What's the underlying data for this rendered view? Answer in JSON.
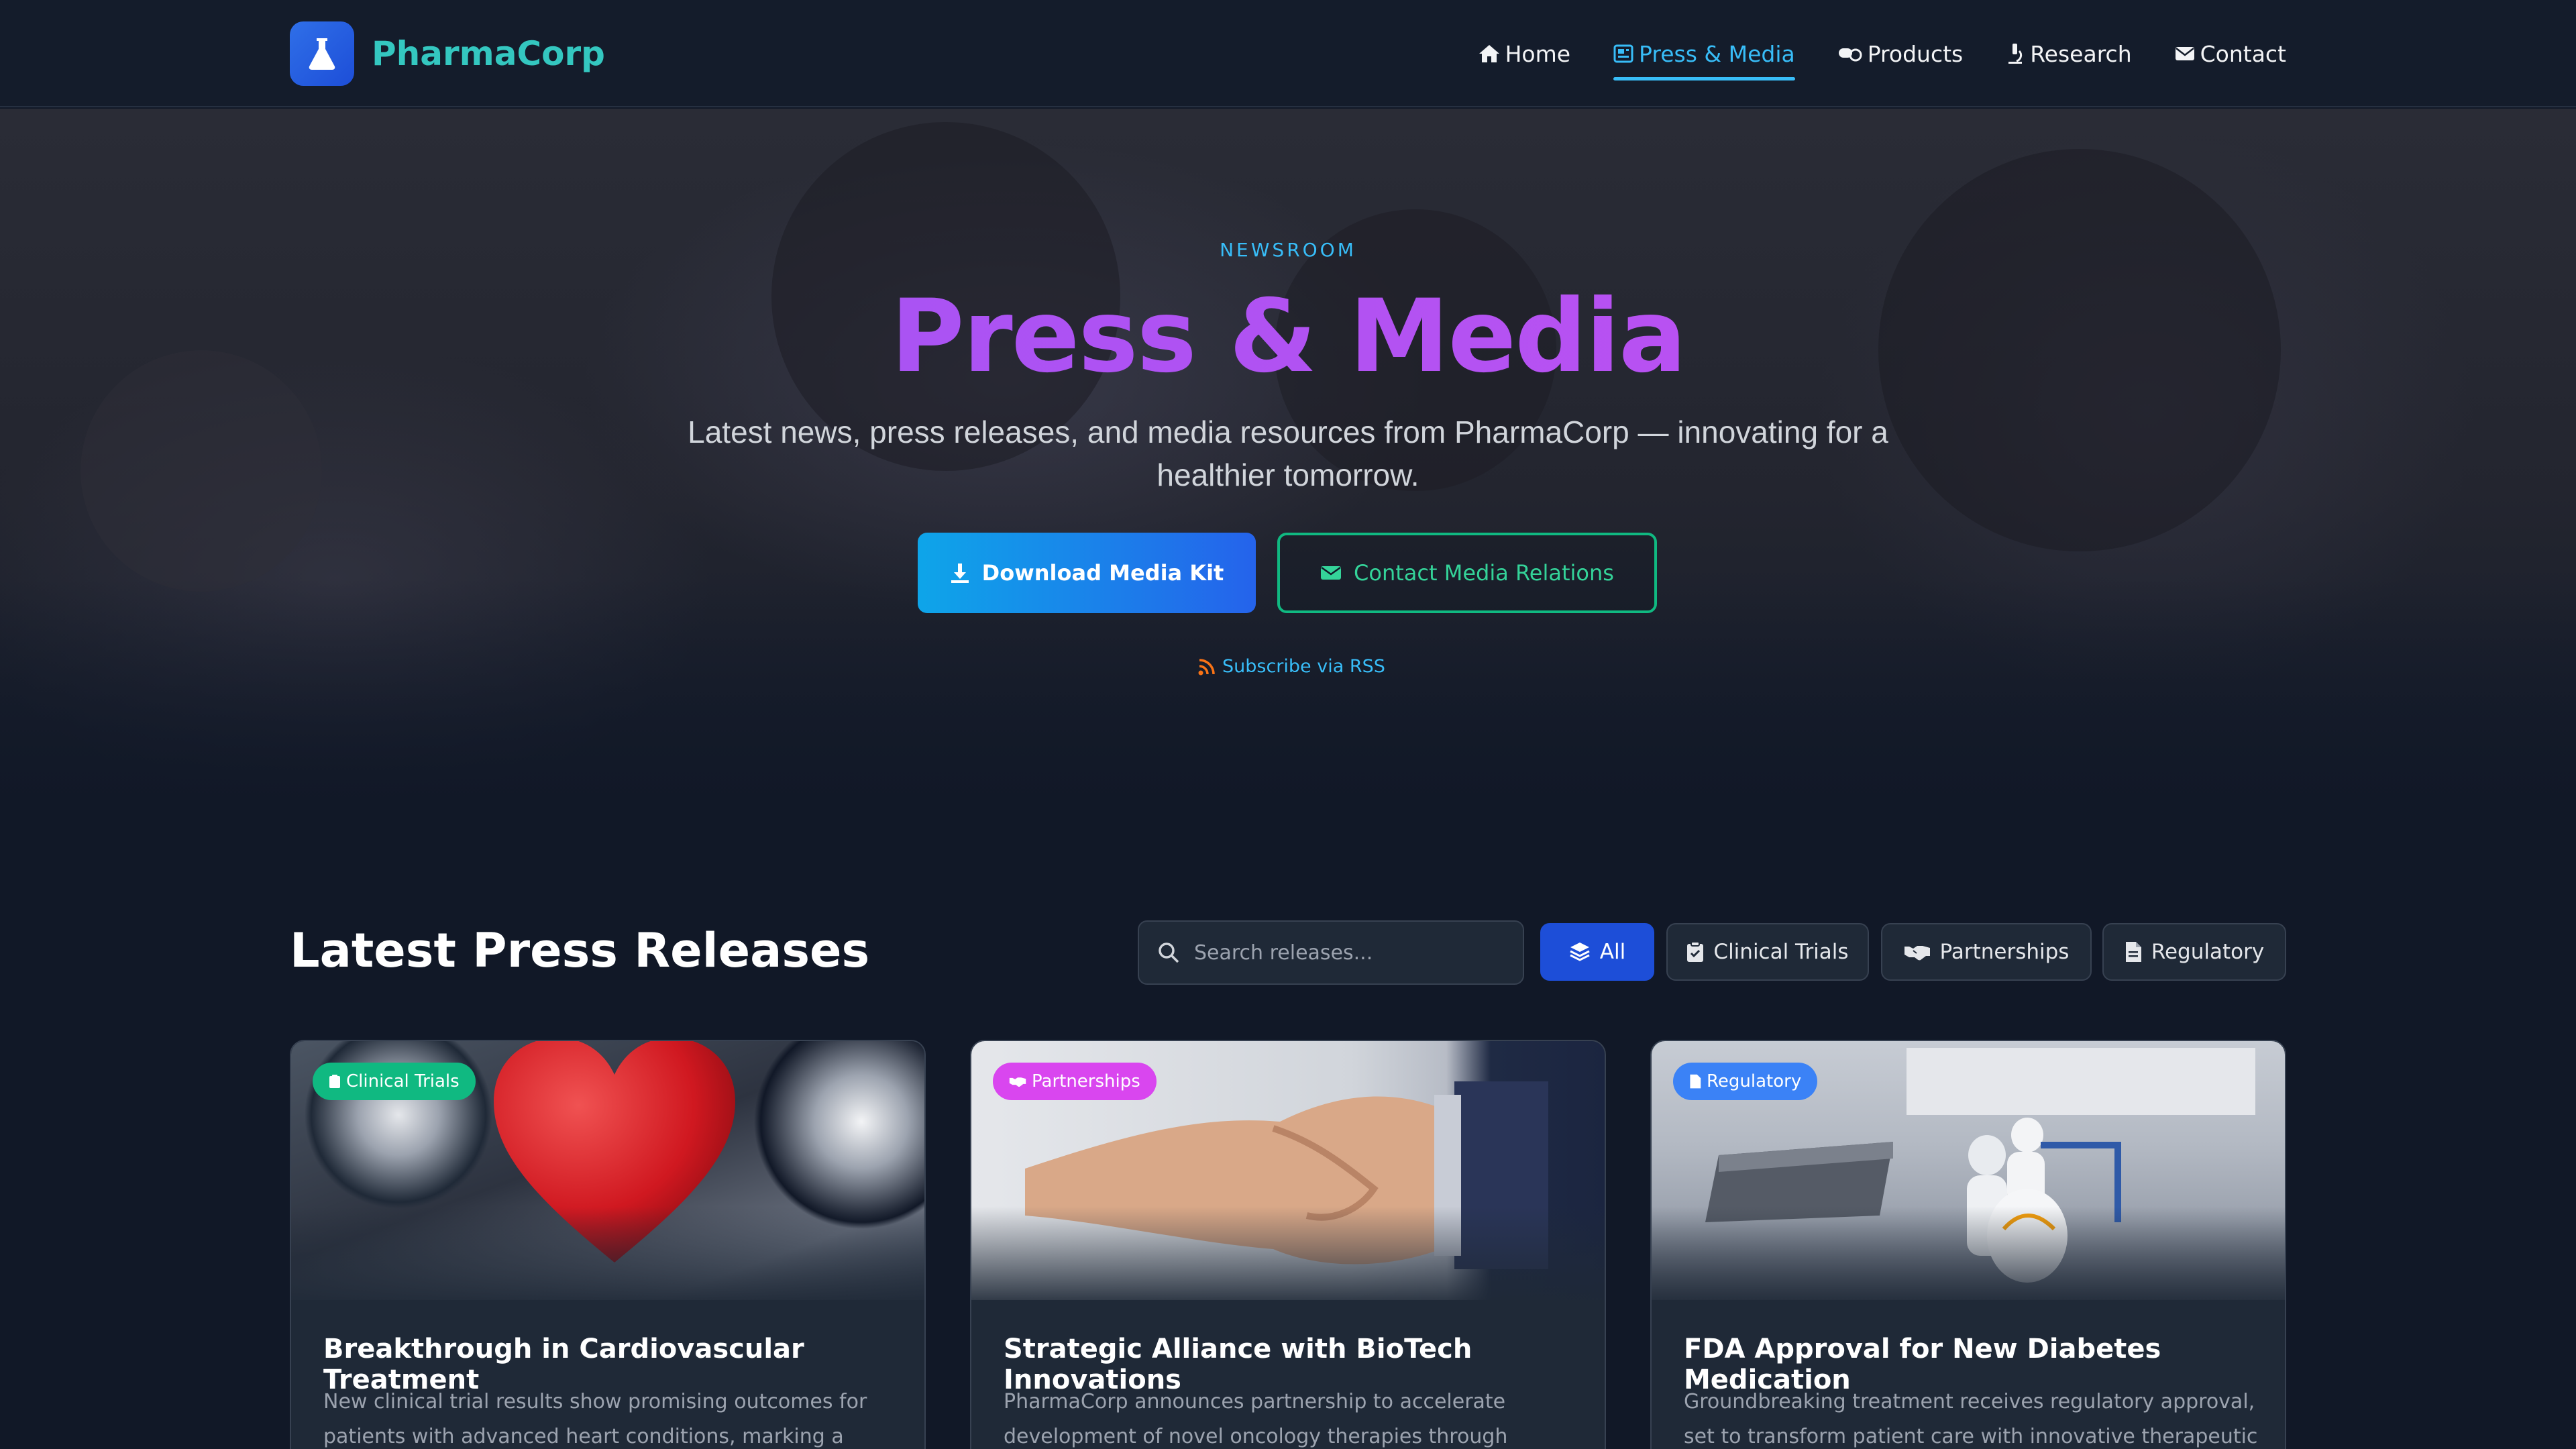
{
  "nav": {
    "brand": "PharmaCorp",
    "links": [
      {
        "label": "Home",
        "icon": "home-icon"
      },
      {
        "label": "Press & Media",
        "icon": "newspaper-icon",
        "active": true
      },
      {
        "label": "Products",
        "icon": "pills-icon"
      },
      {
        "label": "Research",
        "icon": "microscope-icon"
      },
      {
        "label": "Contact",
        "icon": "envelope-icon"
      }
    ]
  },
  "hero": {
    "eyebrow": "NEWSROOM",
    "title": "Press & Media",
    "subtitle": "Latest news, press releases, and media resources from PharmaCorp — innovating for a healthier tomorrow.",
    "primary_button": "Download Media Kit",
    "secondary_button": "Contact Media Relations",
    "rss_link": "Subscribe via RSS"
  },
  "releases": {
    "title": "Latest Press Releases",
    "search_placeholder": "Search releases...",
    "filters": [
      "All",
      "Clinical Trials",
      "Partnerships",
      "Regulatory"
    ],
    "active_filter": "All",
    "cards": [
      {
        "badge": "Clinical Trials",
        "badge_color": "#10b981",
        "title": "Breakthrough in Cardiovascular Treatment",
        "text": "New clinical trial results show promising outcomes for patients with advanced heart conditions, marking a"
      },
      {
        "badge": "Partnerships",
        "badge_color": "#d946ef",
        "title": "Strategic Alliance with BioTech Innovations",
        "text": "PharmaCorp announces partnership to accelerate development of novel oncology therapies through"
      },
      {
        "badge": "Regulatory",
        "badge_color": "#3b82f6",
        "title": "FDA Approval for New Diabetes Medication",
        "text": "Groundbreaking treatment receives regulatory approval, set to transform patient care with innovative therapeutic"
      }
    ]
  },
  "colors": {
    "accent": "#38bdf8",
    "brand": "#34c7c0",
    "title_gradient": [
      "#9a55f5",
      "#c84ff0"
    ],
    "primary_button": "#2563eb",
    "secondary_border": "#10b981"
  }
}
